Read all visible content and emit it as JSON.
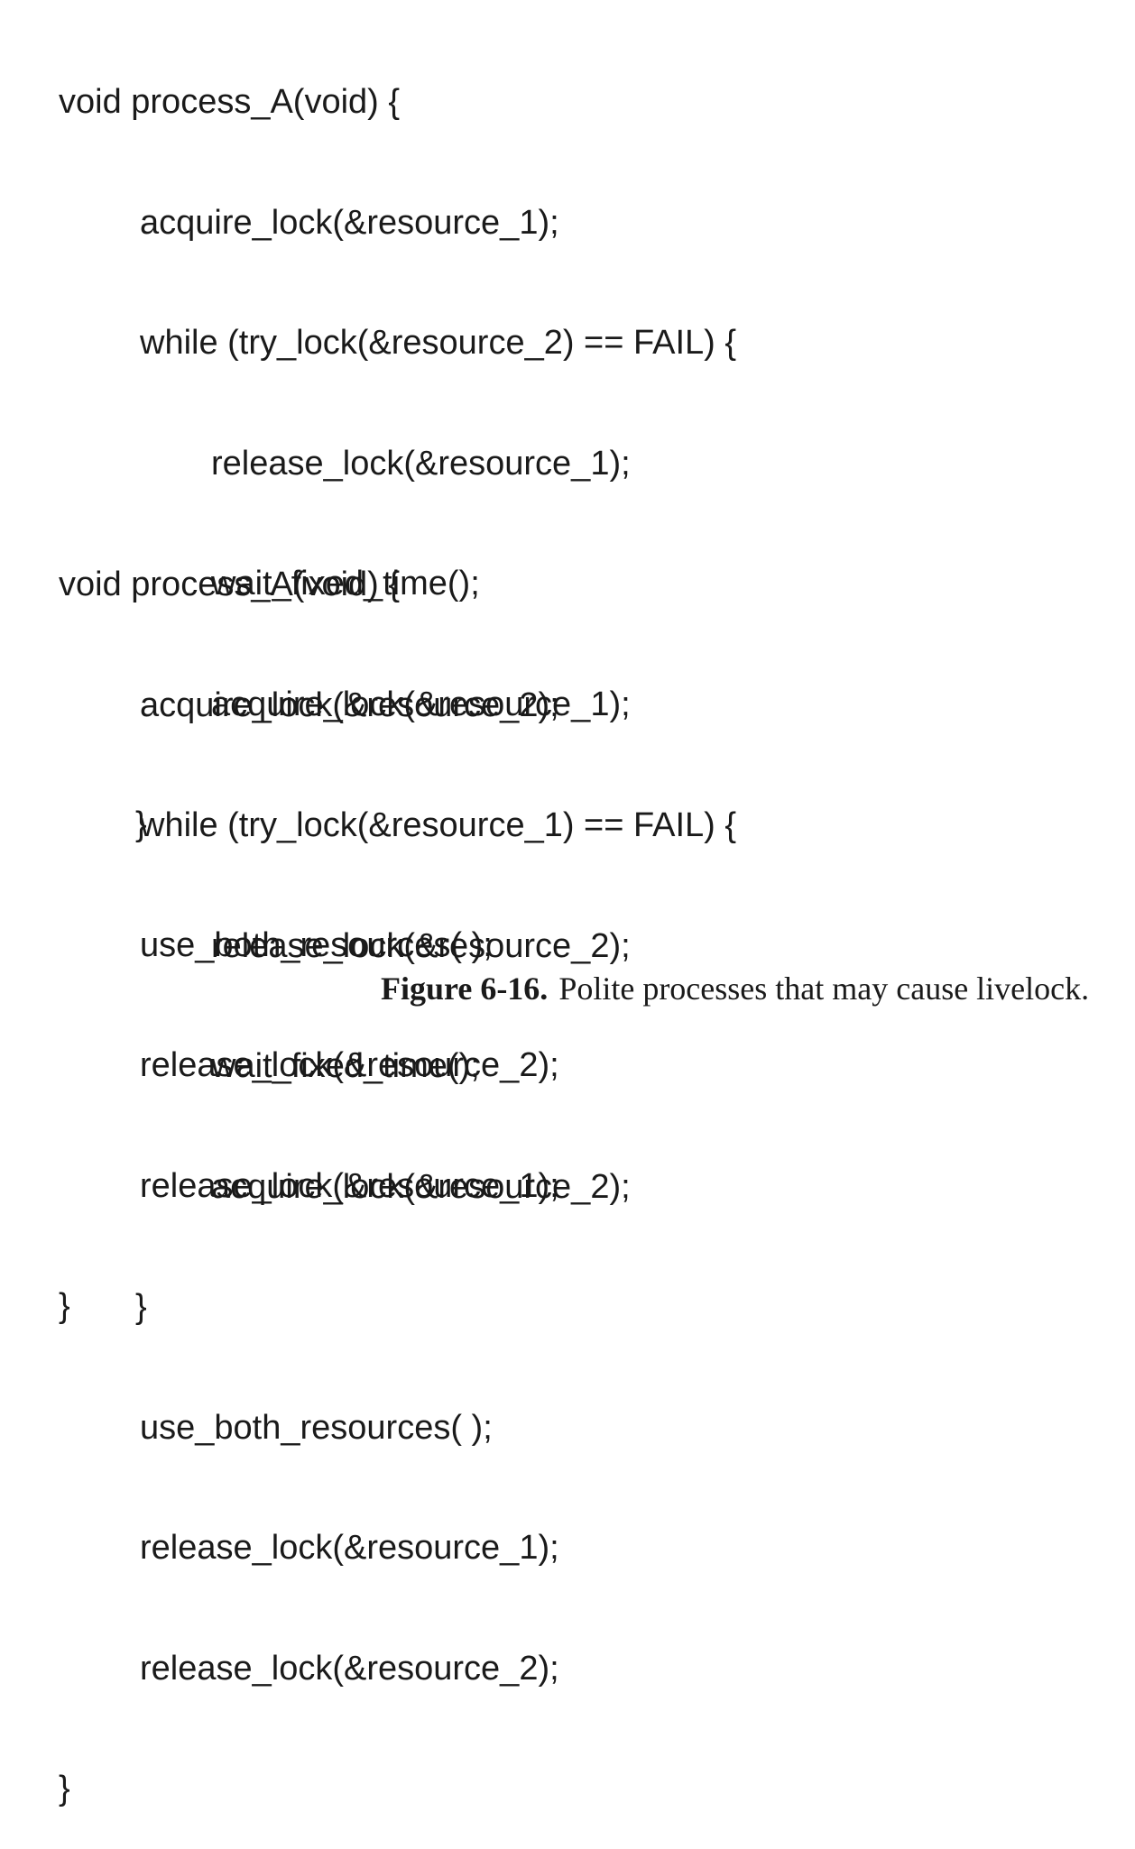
{
  "code_blocks": [
    {
      "lines": [
        "void process_A(void) {",
        "acquire_lock(&resource_1);",
        "while (try_lock(&resource_2) == FAIL) {",
        "release_lock(&resource_1);",
        "wait_fixed_time();",
        "acquire_lock(&resource_1);",
        "}",
        "use_both_resources( );",
        "release_lock(&resource_2);",
        "release_lock(&resource_1);",
        "}"
      ]
    },
    {
      "lines": [
        "void process_A(void) {",
        "acquire_lock(&resource_2);",
        "while (try_lock(&resource_1) == FAIL) {",
        "release_lock(&resource_2);",
        "wait_fixed_time();",
        "acquire_lock(&resource_2);",
        "}",
        "use_both_resources( );",
        "release_lock(&resource_1);",
        "release_lock(&resource_2);",
        "}"
      ]
    }
  ],
  "caption": {
    "label": "Figure 6-16.",
    "text": "Polite processes that may cause livelock."
  }
}
